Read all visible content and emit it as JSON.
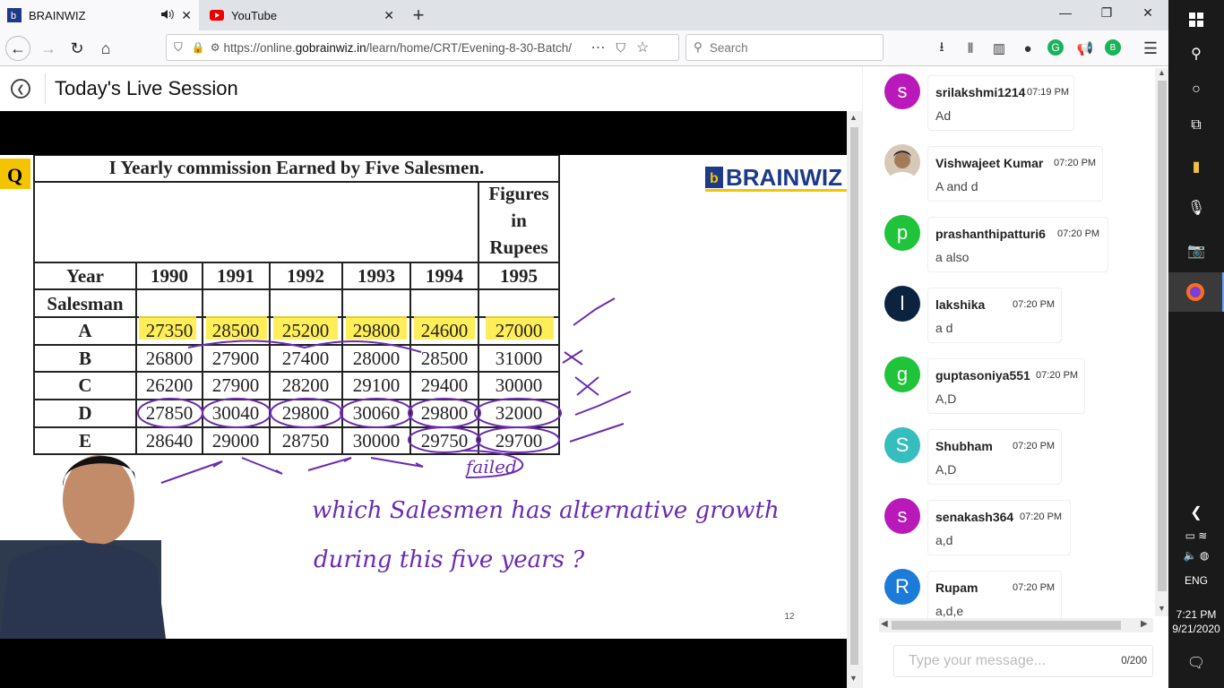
{
  "tabs": [
    {
      "title": "BRAINWIZ",
      "active": true
    },
    {
      "title": "YouTube",
      "active": false
    }
  ],
  "url": {
    "prefix": "https://online.",
    "domain": "gobrainwiz.in",
    "path": "/learn/home/CRT/Evening-8-30-Batch/"
  },
  "search": {
    "placeholder": "Search"
  },
  "session": {
    "title": "Today's Live Session"
  },
  "slide": {
    "q_label": "Q",
    "table_title": "I Yearly commission Earned by Five Salesmen.",
    "figures_note": [
      "Figures",
      "in",
      "Rupees"
    ],
    "brand": "BRAINWIZ",
    "headers": [
      "Year",
      "1990",
      "1991",
      "1992",
      "1993",
      "1994",
      "1995"
    ],
    "salesman_label": "Salesman",
    "rows": [
      {
        "name": "A",
        "values": [
          "27350",
          "28500",
          "25200",
          "29800",
          "24600",
          "27000"
        ]
      },
      {
        "name": "B",
        "values": [
          "26800",
          "27900",
          "27400",
          "28000",
          "28500",
          "31000"
        ]
      },
      {
        "name": "C",
        "values": [
          "26200",
          "27900",
          "28200",
          "29100",
          "29400",
          "30000"
        ]
      },
      {
        "name": "D",
        "values": [
          "27850",
          "30040",
          "29800",
          "30060",
          "29800",
          "32000"
        ]
      },
      {
        "name": "E",
        "values": [
          "28640",
          "29000",
          "28750",
          "30000",
          "29750",
          "29700"
        ]
      }
    ],
    "handwriting": {
      "line1": "which Salesmen has alternative growth",
      "line2": "during this five years ?",
      "note": "failed"
    },
    "page_num": "12"
  },
  "chat": {
    "messages": [
      {
        "initial": "s",
        "color": "#b819b8",
        "name": "srilakshmi1214",
        "time": "07:19 PM",
        "text": "Ad"
      },
      {
        "initial": "",
        "color": "#8a6a55",
        "name": "Vishwajeet Kumar",
        "time": "07:20 PM",
        "text": "A and d"
      },
      {
        "initial": "p",
        "color": "#1fc43a",
        "name": "prashanthipatturi6",
        "time": "07:20 PM",
        "text": "a also"
      },
      {
        "initial": "l",
        "color": "#0c2340",
        "name": "lakshika",
        "time": "07:20 PM",
        "text": "a d"
      },
      {
        "initial": "g",
        "color": "#1fc43a",
        "name": "guptasoniya551",
        "time": "07:20 PM",
        "text": "A,D"
      },
      {
        "initial": "S",
        "color": "#36bdbd",
        "name": "Shubham",
        "time": "07:20 PM",
        "text": "A,D"
      },
      {
        "initial": "s",
        "color": "#b819b8",
        "name": "senakash364",
        "time": "07:20 PM",
        "text": "a,d"
      },
      {
        "initial": "R",
        "color": "#1c7ad8",
        "name": "Rupam",
        "time": "07:20 PM",
        "text": "a,d,e"
      }
    ],
    "input_placeholder": "Type your message...",
    "char_count": "0/200"
  },
  "taskbar": {
    "lang": "ENG",
    "time": "7:21 PM",
    "date": "9/21/2020"
  }
}
